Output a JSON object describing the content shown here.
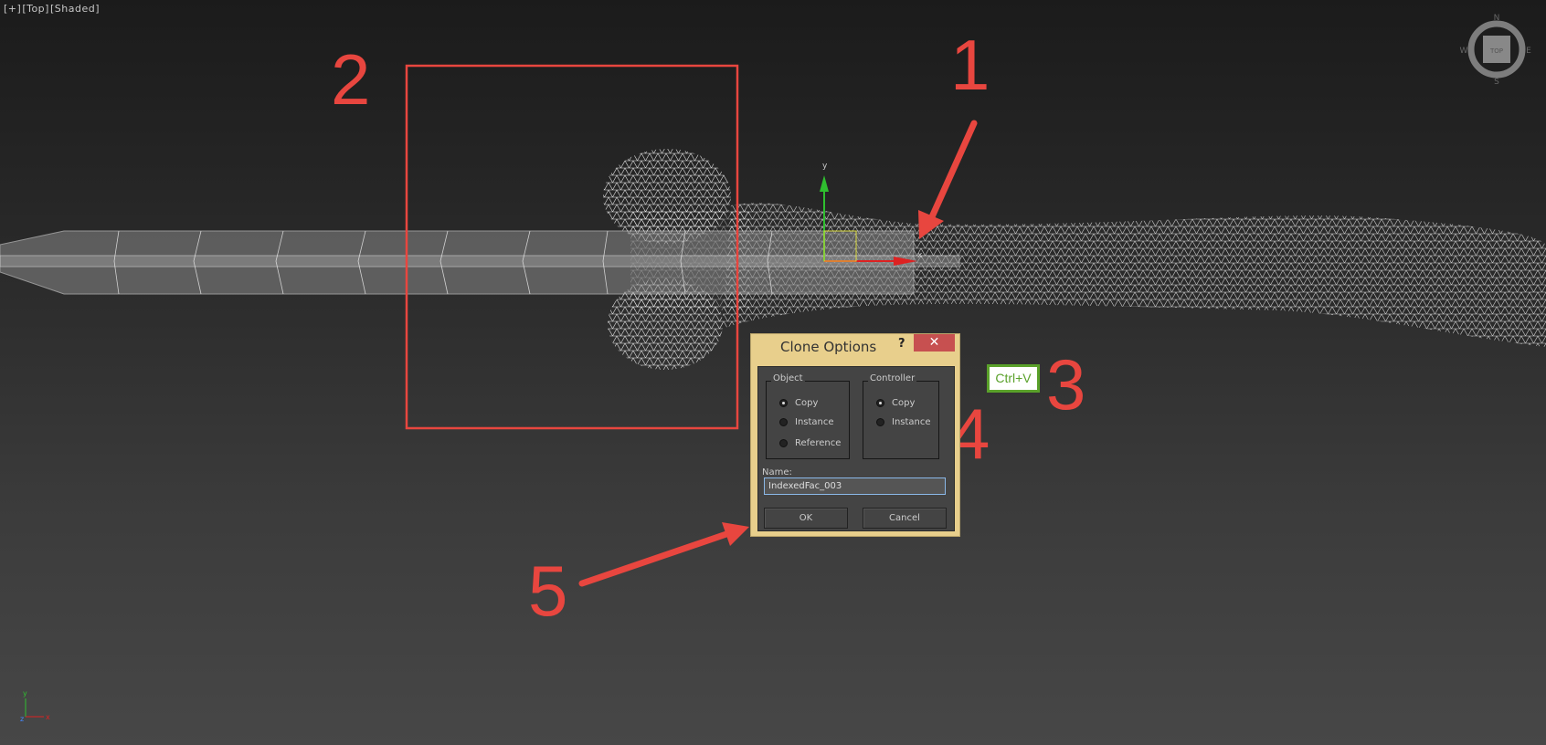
{
  "viewport": {
    "labels": [
      "[+]",
      "[Top]",
      "[Shaded]"
    ]
  },
  "viewcube": {
    "face": "TOP",
    "compass": {
      "n": "N",
      "w": "W",
      "e": "E",
      "s": "S"
    }
  },
  "gizmo": {
    "x": "x",
    "y": "y"
  },
  "axis_tripod": {
    "x": "x",
    "y": "y",
    "z": "z"
  },
  "dialog": {
    "title": "Clone Options",
    "help": "?",
    "close": "✕",
    "object_group": {
      "label": "Object",
      "options": [
        {
          "label": "Copy",
          "selected": true
        },
        {
          "label": "Instance",
          "selected": false
        },
        {
          "label": "Reference",
          "selected": false
        }
      ]
    },
    "controller_group": {
      "label": "Controller",
      "options": [
        {
          "label": "Copy",
          "selected": true
        },
        {
          "label": "Instance",
          "selected": false
        }
      ]
    },
    "name_label": "Name:",
    "name_value": "IndexedFac_003",
    "ok": "OK",
    "cancel": "Cancel"
  },
  "annotations": {
    "n1": "1",
    "n2": "2",
    "n3": "3",
    "n4": "4",
    "n5": "5",
    "shortcut": "Ctrl+V"
  },
  "colors": {
    "annotation": "#e8463f",
    "shortcut": "#5aa12a",
    "dialog_frame": "#e8cf8c"
  }
}
